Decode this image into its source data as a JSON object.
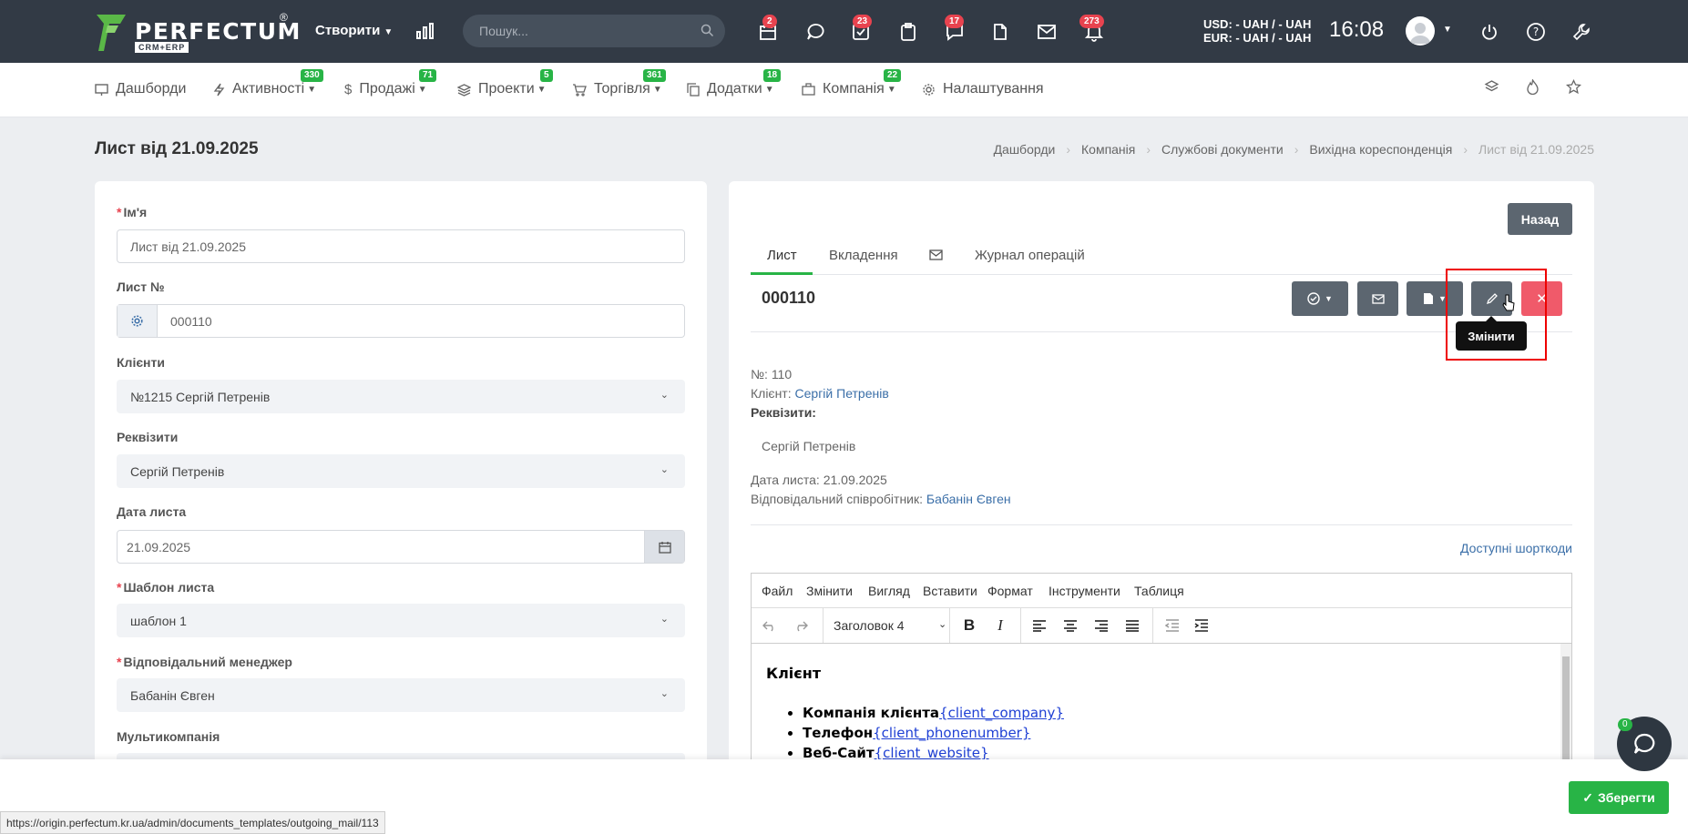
{
  "topbar": {
    "brand": "PERFECTUM",
    "brand_sub": "CRM+ERP",
    "brand_reg": "®",
    "create_label": "Створити",
    "search_placeholder": "Пошук...",
    "badges": {
      "calendar": "2",
      "tasks": "23",
      "chat": "17",
      "notifications": "273"
    },
    "usd_line": "USD: - UAH / - UAH",
    "eur_line": "EUR: - UAH / - UAH",
    "time": "16:08"
  },
  "nav": {
    "items": [
      {
        "label": "Дашборди",
        "badge": ""
      },
      {
        "label": "Активності",
        "badge": "330"
      },
      {
        "label": "Продажі",
        "badge": "71"
      },
      {
        "label": "Проекти",
        "badge": "5"
      },
      {
        "label": "Торгівля",
        "badge": "361"
      },
      {
        "label": "Додатки",
        "badge": "18"
      },
      {
        "label": "Компанія",
        "badge": "22"
      },
      {
        "label": "Налаштування",
        "badge": ""
      }
    ]
  },
  "page": {
    "title": "Лист від 21.09.2025",
    "breadcrumb": [
      "Дашборди",
      "Компанія",
      "Службові документи",
      "Вихідна кореспонденція",
      "Лист від 21.09.2025"
    ]
  },
  "form": {
    "name_label": "Ім'я",
    "name_value": "Лист від 21.09.2025",
    "number_label": "Лист №",
    "number_value": "000110",
    "clients_label": "Клієнти",
    "clients_value": "№1215 Сергій Петренів",
    "requisites_label": "Реквізити",
    "requisites_value": "Сергій Петренів",
    "date_label": "Дата листа",
    "date_value": "21.09.2025",
    "template_label": "Шаблон листа",
    "template_value": "шаблон 1",
    "manager_label": "Відповідальний менеджер",
    "manager_value": "Бабанін Євген",
    "multicompany_label": "Мультикомпанія"
  },
  "detail": {
    "back_label": "Назад",
    "tabs": [
      "Лист",
      "Вкладення",
      "Журнал операцій"
    ],
    "doc_number": "000110",
    "tooltip": "Змінити",
    "number_line_label": "№:",
    "number_line_value": "110",
    "client_label": "Клієнт:",
    "client_value": "Сергій Петренів",
    "requisites_label": "Реквізити:",
    "requisites_value": "Сергій Петренів",
    "date_label": "Дата листа:",
    "date_value": "21.09.2025",
    "employee_label": "Відповідальний співробітник:",
    "employee_value": "Бабанін Євген",
    "shortcodes": "Доступні шорткоди"
  },
  "editor": {
    "menu": [
      "Файл",
      "Змінити",
      "Вигляд",
      "Вставити",
      "Формат",
      "Інструменти",
      "Таблиця"
    ],
    "block_format": "Заголовок 4",
    "heading": "Клієнт",
    "items": [
      {
        "bold": "Компанія клієнта",
        "code": "{client_company}"
      },
      {
        "bold": "Телефон",
        "code": "{client_phonenumber}"
      },
      {
        "bold": "Веб-Сайт",
        "code": "{client_website}"
      }
    ]
  },
  "footer": {
    "save_label": "Зберегти",
    "status_url": "https://origin.perfectum.kr.ua/admin/documents_templates/outgoing_mail/113",
    "chat_badge": "0"
  }
}
